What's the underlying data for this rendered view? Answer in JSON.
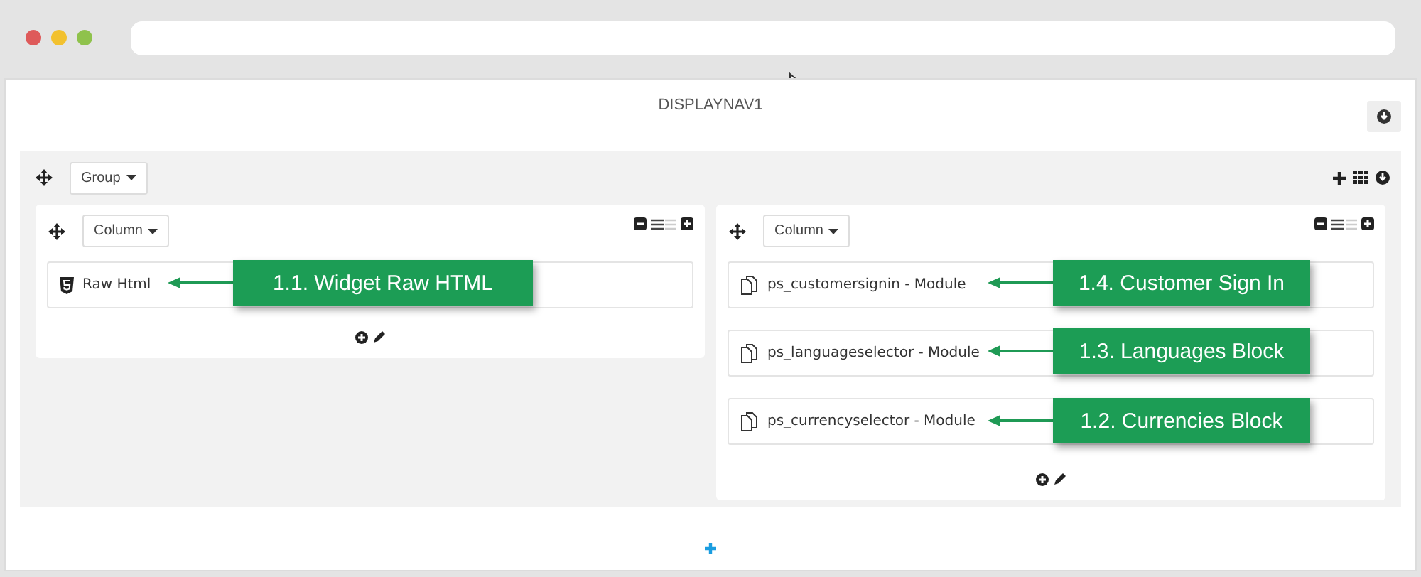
{
  "hook": {
    "title": "DISPLAYNAV1"
  },
  "group": {
    "label": "Group"
  },
  "columns": [
    {
      "label": "Column",
      "widgets": [
        {
          "kind": "html",
          "label": "Raw Html",
          "callout": "1.1. Widget Raw HTML"
        }
      ]
    },
    {
      "label": "Column",
      "widgets": [
        {
          "kind": "module",
          "label": "ps_customersignin - Module",
          "callout": "1.4. Customer Sign In"
        },
        {
          "kind": "module",
          "label": "ps_languageselector - Module",
          "callout": "1.3. Languages Block"
        },
        {
          "kind": "module",
          "label": "ps_currencyselector - Module",
          "callout": "1.2. Currencies Block"
        }
      ]
    }
  ]
}
